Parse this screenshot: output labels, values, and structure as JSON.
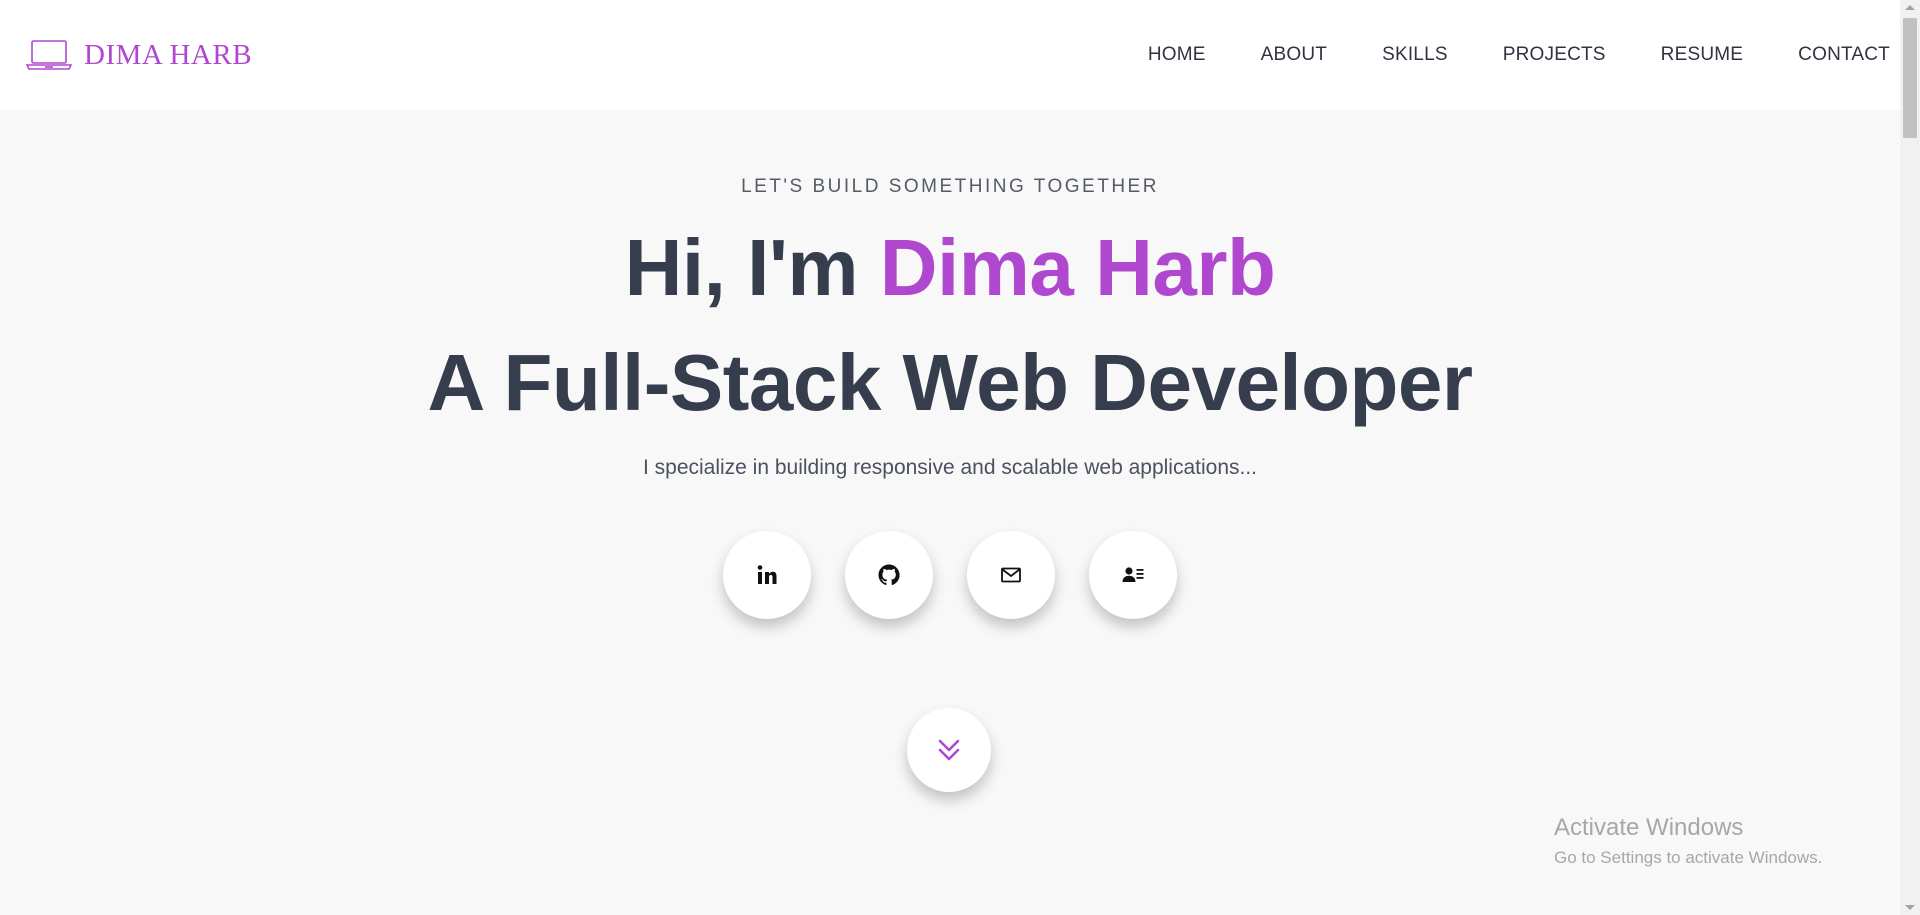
{
  "brand": {
    "name": "DIMA HARB",
    "color": "#b048cf"
  },
  "nav": {
    "items": [
      {
        "label": "HOME"
      },
      {
        "label": "ABOUT"
      },
      {
        "label": "SKILLS"
      },
      {
        "label": "PROJECTS"
      },
      {
        "label": "RESUME"
      },
      {
        "label": "CONTACT"
      }
    ]
  },
  "hero": {
    "tagline": "LET'S BUILD SOMETHING TOGETHER",
    "greeting_prefix": "Hi, I'm ",
    "greeting_name": "Dima Harb",
    "role": "A Full-Stack Web Developer",
    "subtitle": "I specialize in building responsive and scalable web applications..."
  },
  "socials": [
    {
      "icon": "linkedin-icon"
    },
    {
      "icon": "github-icon"
    },
    {
      "icon": "mail-icon"
    },
    {
      "icon": "contact-card-icon"
    }
  ],
  "scroll": {
    "icon": "double-chevron-down-icon"
  },
  "watermark": {
    "title": "Activate Windows",
    "subtitle": "Go to Settings to activate Windows."
  },
  "colors": {
    "accent": "#b048cf",
    "heading": "#363d4d",
    "background": "#f8f8f8",
    "header_bg": "#ffffff"
  }
}
